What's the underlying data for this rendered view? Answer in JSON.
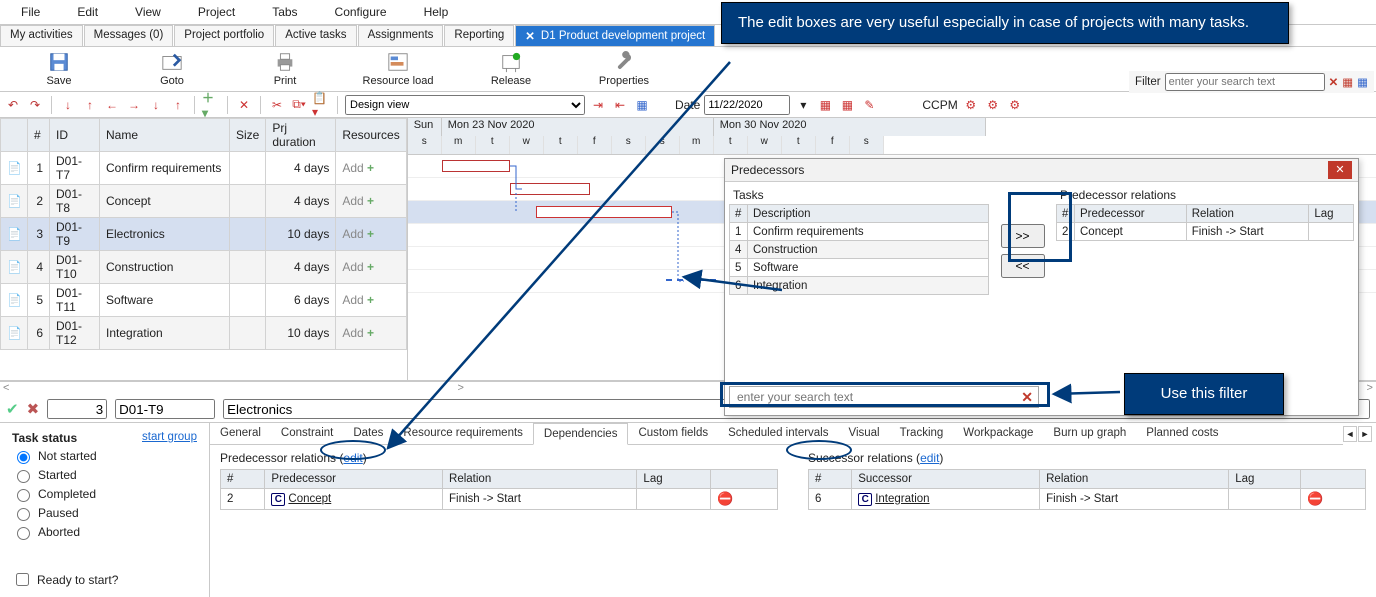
{
  "menu": {
    "file": "File",
    "edit": "Edit",
    "view": "View",
    "project": "Project",
    "tabs": "Tabs",
    "configure": "Configure",
    "help": "Help"
  },
  "tabs": {
    "myact": "My activities",
    "messages": "Messages (0)",
    "portfolio": "Project portfolio",
    "active": "Active tasks",
    "assign": "Assignments",
    "report": "Reporting",
    "project": "D1 Product development project"
  },
  "bigtb": {
    "save": "Save",
    "goto": "Goto",
    "print": "Print",
    "resload": "Resource load",
    "release": "Release",
    "props": "Properties"
  },
  "smalltb": {
    "view_select": "Design view",
    "date_label": "Date",
    "date_value": "11/22/2020",
    "ccpm": "CCPM"
  },
  "filterbar": {
    "label": "Filter",
    "placeholder": "enter your search text"
  },
  "grid": {
    "cols": {
      "idx": "#",
      "id": "ID",
      "name": "Name",
      "size": "Size",
      "dur": "Prj duration",
      "res": "Resources"
    },
    "rows": [
      {
        "i": "1",
        "id": "D01-T7",
        "name": "Confirm requirements",
        "size": "",
        "dur": "4 days",
        "res": "Add"
      },
      {
        "i": "2",
        "id": "D01-T8",
        "name": "Concept",
        "size": "",
        "dur": "4 days",
        "res": "Add"
      },
      {
        "i": "3",
        "id": "D01-T9",
        "name": "Electronics",
        "size": "",
        "dur": "10 days",
        "res": "Add"
      },
      {
        "i": "4",
        "id": "D01-T10",
        "name": "Construction",
        "size": "",
        "dur": "4 days",
        "res": "Add"
      },
      {
        "i": "5",
        "id": "D01-T11",
        "name": "Software",
        "size": "",
        "dur": "6 days",
        "res": "Add"
      },
      {
        "i": "6",
        "id": "D01-T12",
        "name": "Integration",
        "size": "",
        "dur": "10 days",
        "res": "Add"
      }
    ]
  },
  "gantt": {
    "week1": "Sun",
    "week2": "Mon 23 Nov 2020",
    "week3": "Mon 30 Nov 2020",
    "days": [
      "s",
      "m",
      "t",
      "w",
      "t",
      "f",
      "s",
      "s",
      "m",
      "t",
      "w",
      "t",
      "f",
      "s"
    ]
  },
  "detail": {
    "idx": "3",
    "code": "D01-T9",
    "name": "Electronics",
    "status_header": "Task status",
    "statuses": {
      "not": "Not started",
      "sta": "Started",
      "com": "Completed",
      "pau": "Paused",
      "abo": "Aborted"
    },
    "group": "start group",
    "ready": "Ready to start?",
    "tabs": {
      "general": "General",
      "constraint": "Constraint",
      "dates": "Dates",
      "resreq": "Resource requirements",
      "dep": "Dependencies",
      "custom": "Custom fields",
      "sched": "Scheduled intervals",
      "visual": "Visual",
      "track": "Tracking",
      "wp": "Workpackage",
      "burn": "Burn up graph",
      "cost": "Planned costs"
    },
    "pred_title": "Predecessor relations",
    "succ_title": "Successor relations",
    "edit_link": "edit",
    "cols": {
      "idx": "#",
      "p": "Predecessor",
      "s": "Successor",
      "rel": "Relation",
      "lag": "Lag"
    },
    "pred_row": {
      "i": "2",
      "name": "Concept",
      "rel": "Finish -> Start"
    },
    "succ_row": {
      "i": "6",
      "name": "Integration",
      "rel": "Finish -> Start"
    }
  },
  "dlg": {
    "title": "Predecessors",
    "tasks_label": "Tasks",
    "tasks_cols": {
      "i": "#",
      "d": "Description"
    },
    "tasks": [
      {
        "i": "1",
        "d": "Confirm requirements"
      },
      {
        "i": "4",
        "d": "Construction"
      },
      {
        "i": "5",
        "d": "Software"
      },
      {
        "i": "6",
        "d": "Integration"
      }
    ],
    "add": ">>",
    "remove": "<<",
    "rels_label": "Predecessor relations",
    "rels_cols": {
      "i": "#",
      "p": "Predecessor",
      "r": "Relation",
      "l": "Lag"
    },
    "rels": [
      {
        "i": "2",
        "p": "Concept",
        "r": "Finish -> Start",
        "l": ""
      }
    ],
    "search_placeholder": "enter your search text"
  },
  "callouts": {
    "c1": "The edit boxes are very useful especially in case of projects with many tasks.",
    "c2": "Use this filter"
  }
}
